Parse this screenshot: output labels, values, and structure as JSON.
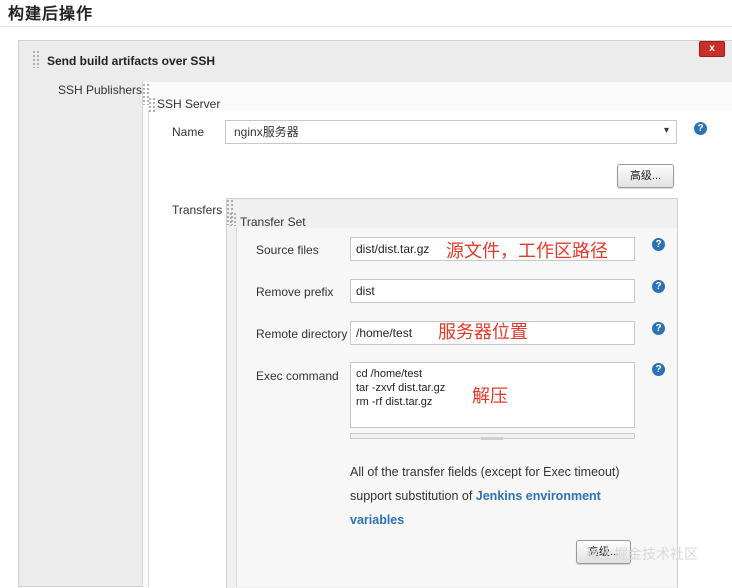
{
  "section": {
    "title": "构建后操作"
  },
  "publisher": {
    "delete_label": "x",
    "title": "Send build artifacts over SSH",
    "ssh_publishers_label": "SSH Publishers",
    "ssh_server_label": "SSH Server",
    "name_label": "Name",
    "name_value": "nginx服务器",
    "advanced_label": "高级...",
    "transfers_label": "Transfers"
  },
  "transfer_set": {
    "title": "Transfer Set",
    "source_files": {
      "label": "Source files",
      "value": "dist/dist.tar.gz",
      "annotation": "源文件，工作区路径"
    },
    "remove_prefix": {
      "label": "Remove prefix",
      "value": "dist"
    },
    "remote_directory": {
      "label": "Remote directory",
      "value": "/home/test",
      "annotation": "服务器位置"
    },
    "exec_command": {
      "label": "Exec command",
      "value": "cd /home/test\ntar -zxvf dist.tar.gz\nrm -rf dist.tar.gz",
      "annotation": "解压"
    },
    "info_text": "All of the transfer fields (except for Exec timeout) support substitution of",
    "info_link": "Jenkins environment variables",
    "advanced_label": "高级..."
  },
  "help_symbol": "?",
  "watermark": "稀土掘金技术社区",
  "colors": {
    "help_icon": "#2c72b8",
    "delete_button": "#c9302c",
    "annotation": "#e53a2a",
    "link": "#2c72b8"
  }
}
